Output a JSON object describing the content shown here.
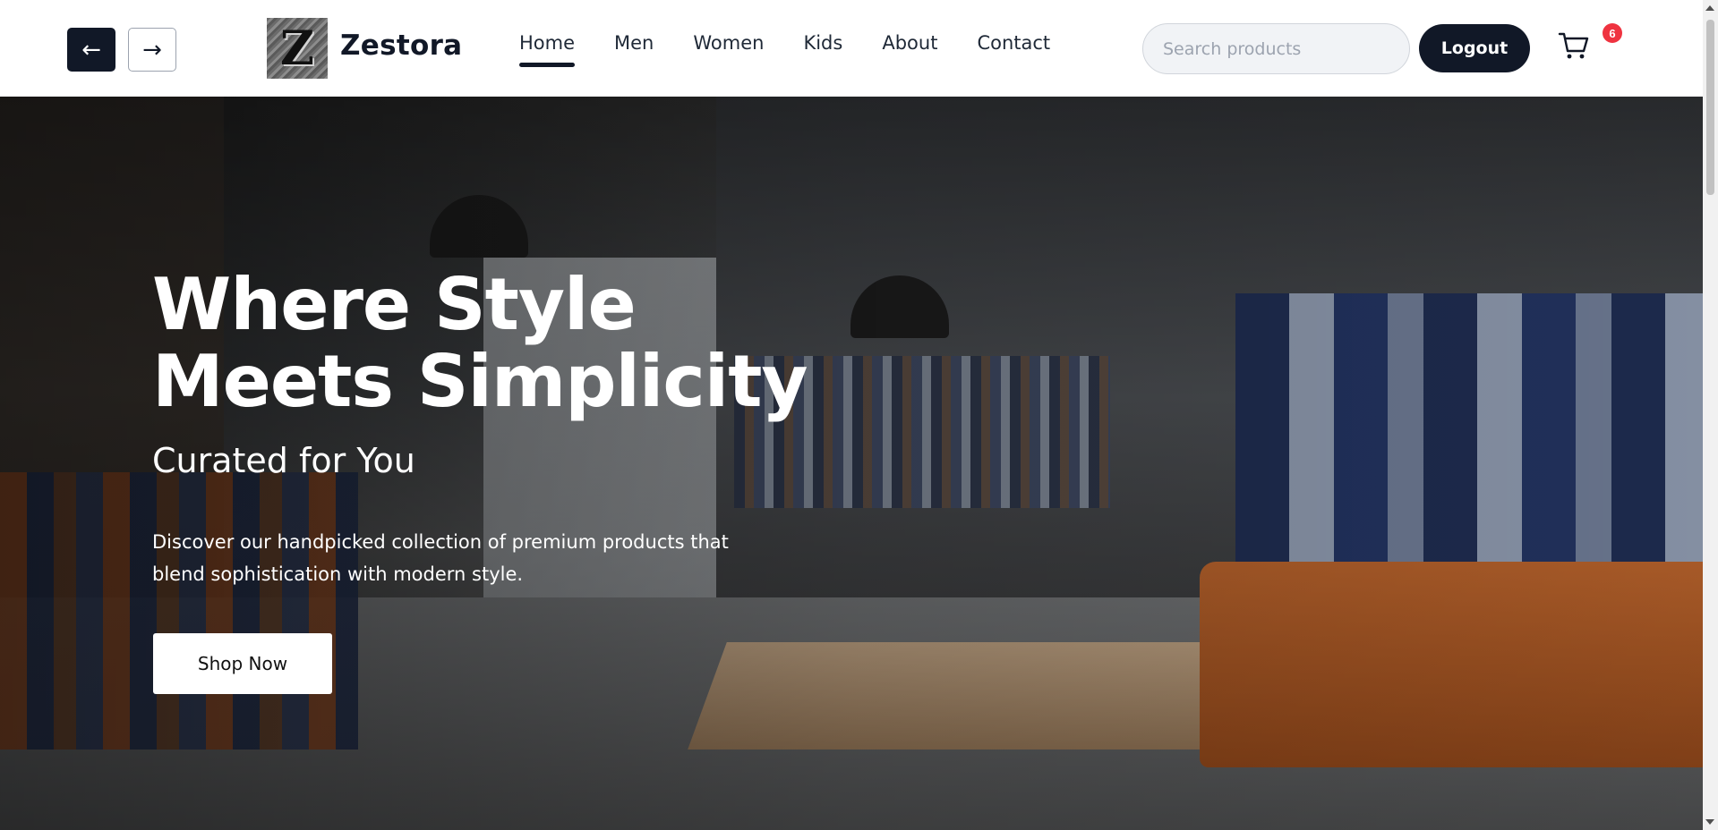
{
  "header": {
    "back_glyph": "←",
    "forward_glyph": "→",
    "logo_letter": "Z",
    "brand": "Zestora",
    "menu": [
      {
        "label": "Home",
        "active": true
      },
      {
        "label": "Men",
        "active": false
      },
      {
        "label": "Women",
        "active": false
      },
      {
        "label": "Kids",
        "active": false
      },
      {
        "label": "About",
        "active": false
      },
      {
        "label": "Contact",
        "active": false
      }
    ],
    "search_placeholder": "Search products",
    "logout_label": "Logout",
    "cart_count": "6"
  },
  "hero": {
    "title_line1": "Where Style",
    "title_line2": "Meets Simplicity",
    "subtitle": "Curated for You",
    "description_line1": "Discover our handpicked collection of premium products that",
    "description_line2": "blend sophistication with modern style.",
    "cta_label": "Shop Now"
  },
  "icons": {
    "cart": "cart-icon"
  },
  "colors": {
    "primary": "#111827",
    "badge": "#ef3340",
    "text_light": "#ffffff"
  }
}
